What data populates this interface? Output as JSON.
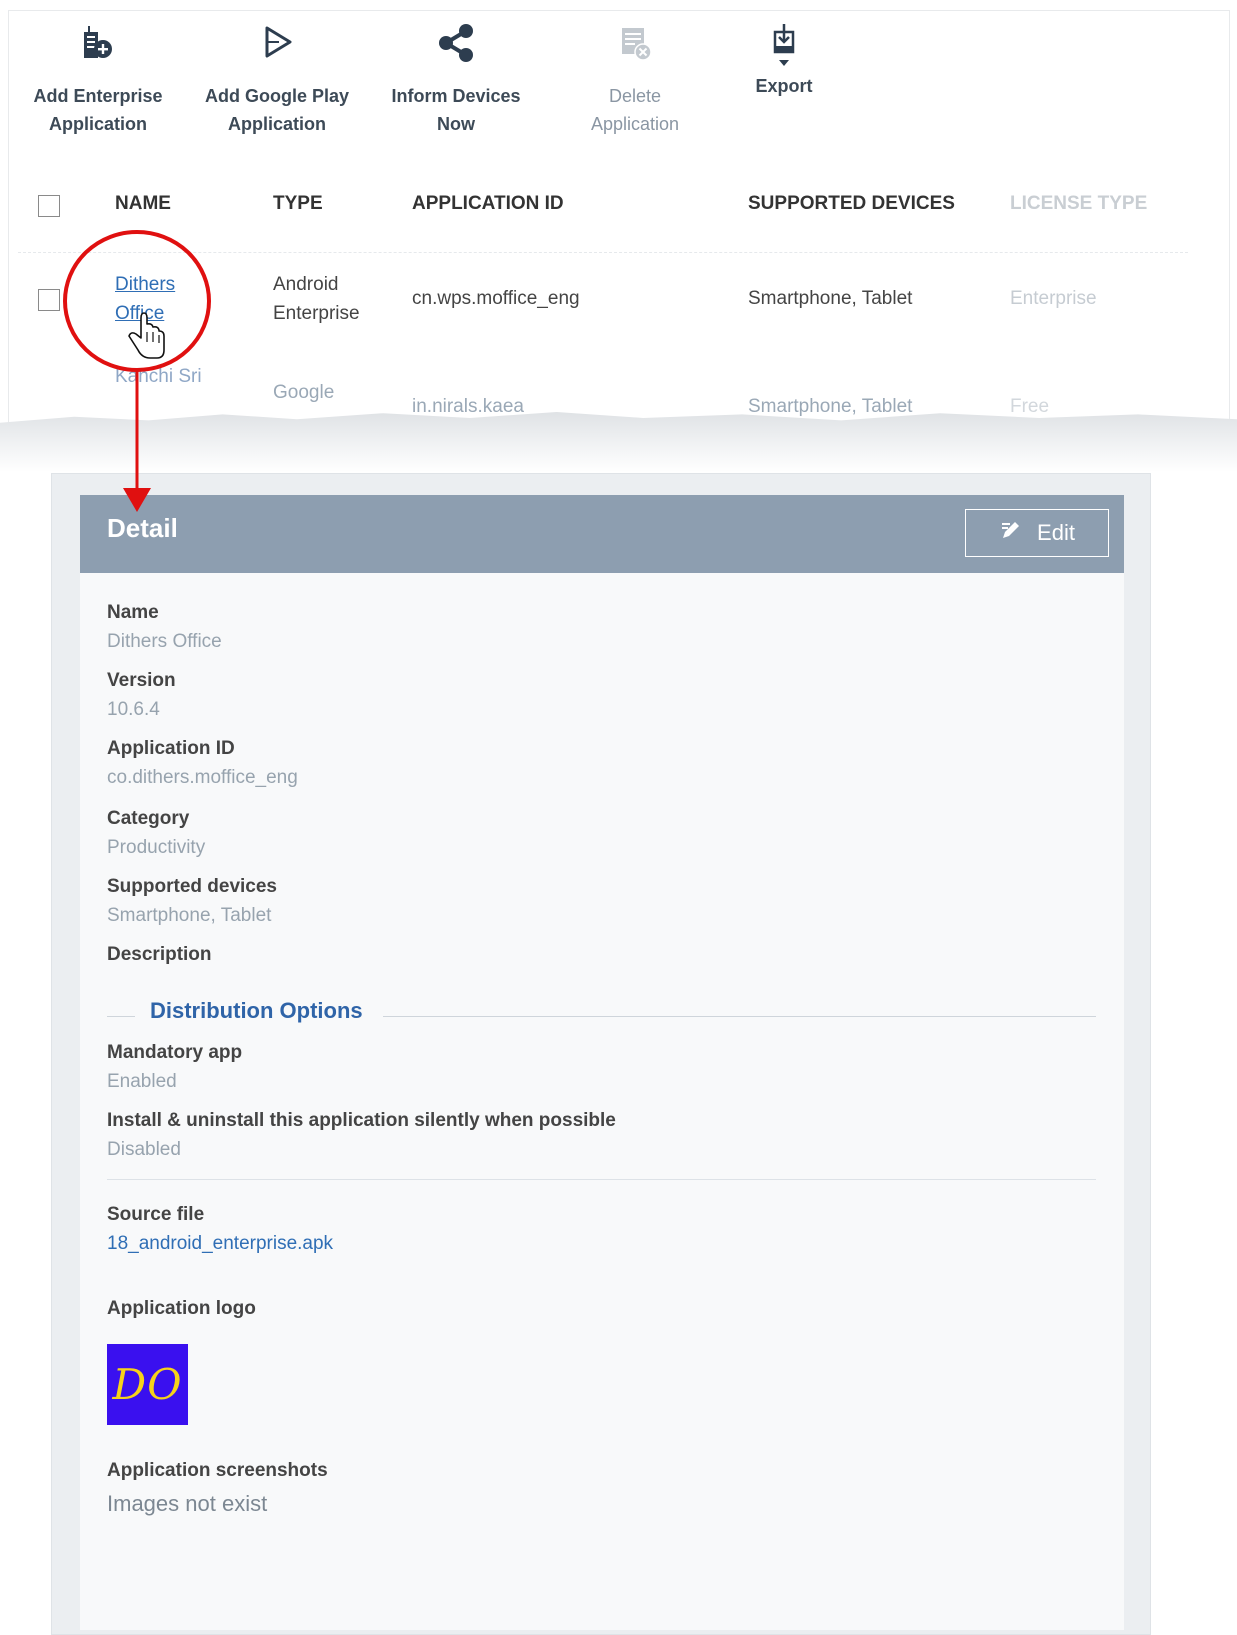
{
  "toolbar": {
    "add_enterprise": "Add Enterprise\nApplication",
    "add_google_play": "Add Google Play\nApplication",
    "inform_devices": "Inform Devices\nNow",
    "delete_application": "Delete\nApplication",
    "export": "Export"
  },
  "table": {
    "headers": {
      "name": "NAME",
      "type": "TYPE",
      "application_id": "APPLICATION ID",
      "supported_devices": "SUPPORTED DEVICES",
      "license_type": "LICENSE TYPE"
    },
    "rows": [
      {
        "name_line1": "Dithers",
        "name_line2": "Office",
        "type_line1": "Android",
        "type_line2": "Enterprise",
        "application_id": "cn.wps.moffice_eng",
        "supported_devices": "Smartphone, Tablet",
        "license_type": "Enterprise"
      },
      {
        "name_line1": "Kanchi Sri",
        "type_line1": "Google",
        "application_id": "in.nirals.kaea",
        "supported_devices": "Smartphone, Tablet",
        "license_type": "Free"
      }
    ]
  },
  "detail": {
    "title": "Detail",
    "edit_label": "Edit",
    "fields": {
      "name_label": "Name",
      "name_value": "Dithers Office",
      "version_label": "Version",
      "version_value": "10.6.4",
      "appid_label": "Application ID",
      "appid_value": "co.dithers.moffice_eng",
      "category_label": "Category",
      "category_value": "Productivity",
      "devices_label": "Supported devices",
      "devices_value": "Smartphone, Tablet",
      "description_label": "Description"
    },
    "distribution": {
      "title": "Distribution Options",
      "mandatory_label": "Mandatory app",
      "mandatory_value": "Enabled",
      "silent_label": "Install & uninstall this application silently when possible",
      "silent_value": "Disabled"
    },
    "source_file_label": "Source file",
    "source_file_value": "18_android_enterprise.apk",
    "logo_label": "Application logo",
    "logo_text": "DO",
    "screenshots_label": "Application screenshots",
    "screenshots_value": "Images not exist"
  },
  "colors": {
    "header_bar": "#8d9eb0",
    "link": "#2f6eb5",
    "annotation_red": "#e01010",
    "logo_bg": "#3a10ef",
    "logo_text": "#f7d21a"
  },
  "icons": [
    "add-enterprise-app-icon",
    "play-icon",
    "share-icon",
    "delete-app-icon",
    "export-icon",
    "pencil-icon",
    "hand-cursor-icon"
  ]
}
